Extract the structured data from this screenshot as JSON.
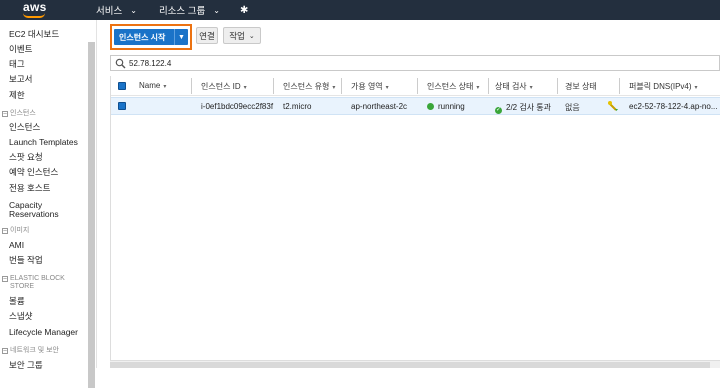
{
  "topbar": {
    "logo_text": "aws",
    "services_label": "서비스",
    "resource_groups_label": "리소스 그룹",
    "caret": "⌄",
    "pin": "✱"
  },
  "sidebar": {
    "items": [
      "EC2 대시보드",
      "이벤트",
      "태그",
      "보고서",
      "제한"
    ],
    "section_instances": "인스턴스",
    "instances_items": [
      "인스턴스",
      "Launch Templates",
      "스팟 요청",
      "예약 인스턴스",
      "전용 호스트",
      "Capacity",
      "Reservations"
    ],
    "section_images": "이미지",
    "images_items": [
      "AMI",
      "번들 작업"
    ],
    "section_ebs_1": "ELASTIC BLOCK",
    "section_ebs_2": "STORE",
    "ebs_items": [
      "볼륨",
      "스냅샷",
      "Lifecycle Manager"
    ],
    "section_network": "네트워크 및 보안",
    "network_items": [
      "보안 그룹"
    ]
  },
  "toolbar": {
    "launch_label": "인스턴스 시작",
    "launch_caret": "▼",
    "connect_label": "연결",
    "actions_label": "작업",
    "actions_caret": "⌄"
  },
  "search": {
    "value": "52.78.122.4",
    "placeholder": ""
  },
  "table": {
    "headers": [
      "Name",
      "인스턴스 ID",
      "인스턴스 유형",
      "가용 영역",
      "인스턴스 상태",
      "상태 검사",
      "경보 상태",
      "퍼블릭 DNS(IPv4)"
    ],
    "sort_caret": "▾",
    "row": {
      "name": "",
      "instance_id": "i-0ef1bdc09ecc2f83f",
      "instance_type": "t2.micro",
      "az": "ap-northeast-2c",
      "state": "running",
      "status_check": "2/2 검사 통과",
      "alarm": "없음",
      "public_dns": "ec2-52-78-122-4.ap-no..."
    }
  },
  "colors": {
    "topbar_bg": "#232f3e",
    "accent_orange": "#ec7211",
    "primary_blue": "#1a73c8",
    "running_green": "#3aa63a"
  }
}
